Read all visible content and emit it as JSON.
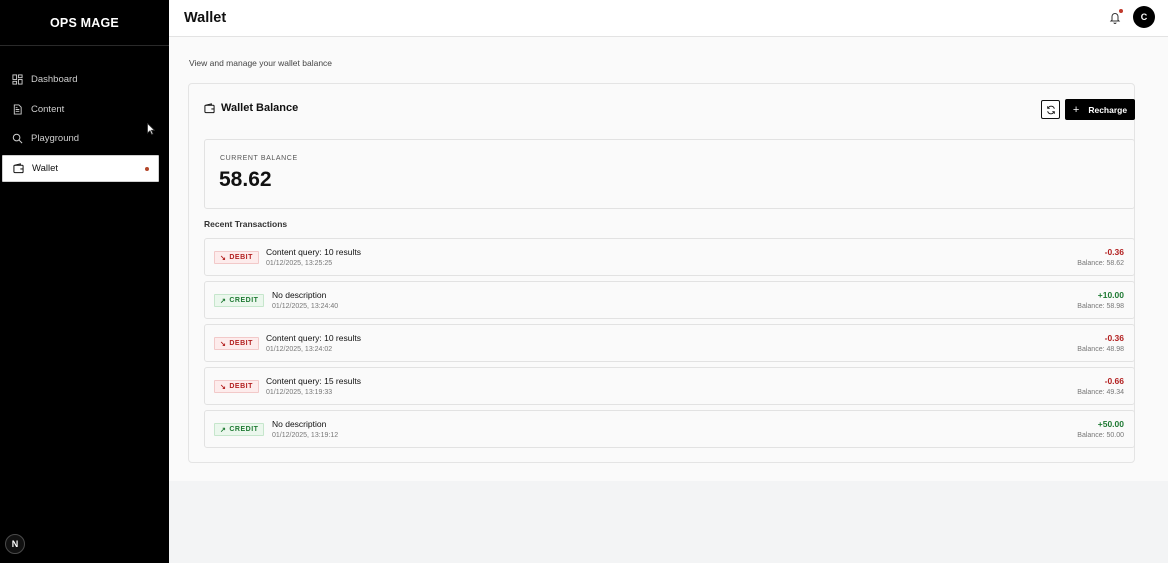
{
  "sidebar": {
    "brand": "OPS MAGE",
    "items": [
      {
        "label": "Dashboard",
        "icon": "dashboard-icon"
      },
      {
        "label": "Content",
        "icon": "document-icon"
      },
      {
        "label": "Playground",
        "icon": "search-icon"
      },
      {
        "label": "Wallet",
        "icon": "wallet-icon",
        "active": true
      }
    ],
    "footer_badge": "N"
  },
  "header": {
    "title": "Wallet",
    "avatar_initial": "C"
  },
  "main": {
    "subtitle": "View and manage your wallet balance",
    "card": {
      "title": "Wallet Balance",
      "recharge_label": "Recharge",
      "balance_label": "CURRENT BALANCE",
      "balance_value": "58.62",
      "recent_title": "Recent Transactions"
    },
    "transactions": [
      {
        "type": "DEBIT",
        "description": "Content query: 10 results",
        "time": "01/12/2025, 13:25:25",
        "amount": "-0.36",
        "balance": "Balance: 58.62"
      },
      {
        "type": "CREDIT",
        "description": "No description",
        "time": "01/12/2025, 13:24:40",
        "amount": "+10.00",
        "balance": "Balance: 58.98"
      },
      {
        "type": "DEBIT",
        "description": "Content query: 10 results",
        "time": "01/12/2025, 13:24:02",
        "amount": "-0.36",
        "balance": "Balance: 48.98"
      },
      {
        "type": "DEBIT",
        "description": "Content query: 15 results",
        "time": "01/12/2025, 13:19:33",
        "amount": "-0.66",
        "balance": "Balance: 49.34"
      },
      {
        "type": "CREDIT",
        "description": "No description",
        "time": "01/12/2025, 13:19:12",
        "amount": "+50.00",
        "balance": "Balance: 50.00"
      }
    ]
  },
  "colors": {
    "sidebar_bg": "#000000",
    "debit": "#b21f1f",
    "credit": "#1f7a33",
    "notification_dot": "#c0392b"
  }
}
